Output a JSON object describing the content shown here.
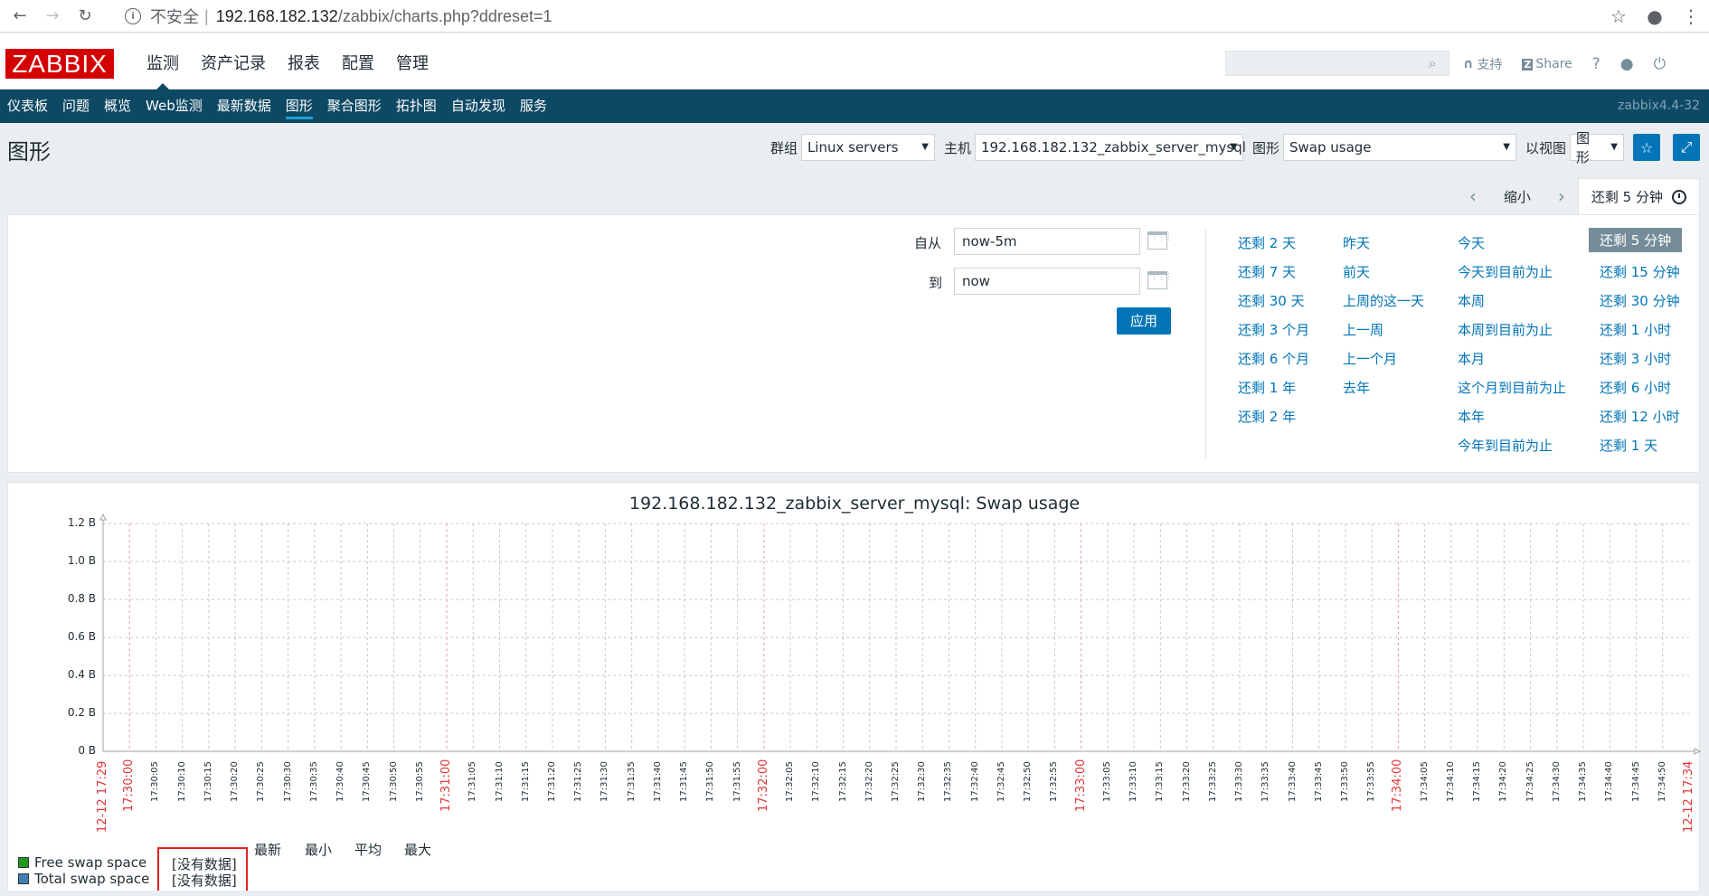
{
  "browser": {
    "insecure_label": "不安全",
    "separator": "|",
    "url_host": "192.168.182.132",
    "url_path": "/zabbix/charts.php?ddreset=1"
  },
  "header": {
    "logo": "ZABBIX",
    "main_menu": [
      "监测",
      "资产记录",
      "报表",
      "配置",
      "管理"
    ],
    "support_label": "支持",
    "share_label": "Share",
    "help_label": "?"
  },
  "sub_menu": {
    "items": [
      "仪表板",
      "问题",
      "概览",
      "Web监测",
      "最新数据",
      "图形",
      "聚合图形",
      "拓扑图",
      "自动发现",
      "服务"
    ],
    "version": "zabbix4.4-32"
  },
  "page": {
    "title": "图形",
    "group_label": "群组",
    "group_value": "Linux servers",
    "host_label": "主机",
    "host_value": "192.168.182.132_zabbix_server_mysql",
    "graph_label": "图形",
    "graph_value": "Swap usage",
    "view_label": "以视图",
    "view_value": "图形"
  },
  "time_nav": {
    "zoom_out": "缩小",
    "current": "还剩 5 分钟"
  },
  "time_panel": {
    "from_label": "自从",
    "from_value": "now-5m",
    "to_label": "到",
    "to_value": "now",
    "apply_label": "应用",
    "col1": [
      "还剩 2 天",
      "还剩 7 天",
      "还剩 30 天",
      "还剩 3 个月",
      "还剩 6 个月",
      "还剩 1 年",
      "还剩 2 年"
    ],
    "col2": [
      "昨天",
      "前天",
      "上周的这一天",
      "上一周",
      "上一个月",
      "去年"
    ],
    "col3": [
      "今天",
      "今天到目前为止",
      "本周",
      "本周到目前为止",
      "本月",
      "这个月到目前为止",
      "本年",
      "今年到目前为止"
    ],
    "col4": [
      "还剩 5 分钟",
      "还剩 15 分钟",
      "还剩 30 分钟",
      "还剩 1 小时",
      "还剩 3 小时",
      "还剩 6 小时",
      "还剩 12 小时",
      "还剩 1 天"
    ]
  },
  "graph": {
    "title": "192.168.182.132_zabbix_server_mysql: Swap usage",
    "y_ticks": [
      "1.2 B",
      "1.0 B",
      "0.8 B",
      "0.6 B",
      "0.4 B",
      "0.2 B",
      "0 B"
    ],
    "x_ticks": [
      "12-12 17:29",
      "17:30:00",
      "17:30:05",
      "17:30:10",
      "17:30:15",
      "17:30:20",
      "17:30:25",
      "17:30:30",
      "17:30:35",
      "17:30:40",
      "17:30:45",
      "17:30:50",
      "17:30:55",
      "17:31:00",
      "17:31:05",
      "17:31:10",
      "17:31:15",
      "17:31:20",
      "17:31:25",
      "17:31:30",
      "17:31:35",
      "17:31:40",
      "17:31:45",
      "17:31:50",
      "17:31:55",
      "17:32:00",
      "17:32:05",
      "17:32:10",
      "17:32:15",
      "17:32:20",
      "17:32:25",
      "17:32:30",
      "17:32:35",
      "17:32:40",
      "17:32:45",
      "17:32:50",
      "17:32:55",
      "17:33:00",
      "17:33:05",
      "17:33:10",
      "17:33:15",
      "17:33:20",
      "17:33:25",
      "17:33:30",
      "17:33:35",
      "17:33:40",
      "17:33:45",
      "17:33:50",
      "17:33:55",
      "17:34:00",
      "17:34:05",
      "17:34:10",
      "17:34:15",
      "17:34:20",
      "17:34:25",
      "17:34:30",
      "17:34:35",
      "17:34:40",
      "17:34:45",
      "17:34:50",
      "12-12 17:34"
    ],
    "major_ticks": [
      "12-12 17:29",
      "17:30:00",
      "17:31:00",
      "17:32:00",
      "17:33:00",
      "17:34:00",
      "12-12 17:34"
    ],
    "legend_headers": [
      "最新",
      "最小",
      "平均",
      "最大"
    ],
    "series": [
      {
        "name": "Free swap space",
        "color": "#1a9b1a",
        "status": "[没有数据]"
      },
      {
        "name": "Total swap space",
        "color": "#3f7fb5",
        "status": "[没有数据]"
      }
    ]
  }
}
